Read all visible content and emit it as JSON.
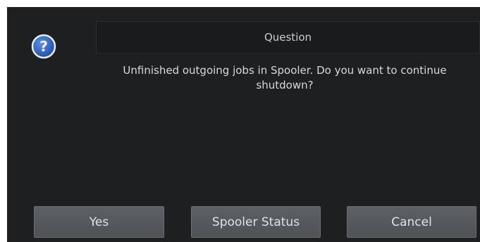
{
  "dialog": {
    "title": "Question",
    "message": "Unfinished outgoing jobs in Spooler. Do you want to continue shutdown?",
    "icon": "question-icon",
    "colors": {
      "background": "#1d1f21",
      "icon_fill": "#2a5fc4",
      "button": "#575b60"
    }
  },
  "buttons": {
    "yes": "Yes",
    "spooler_status": "Spooler Status",
    "cancel": "Cancel"
  }
}
